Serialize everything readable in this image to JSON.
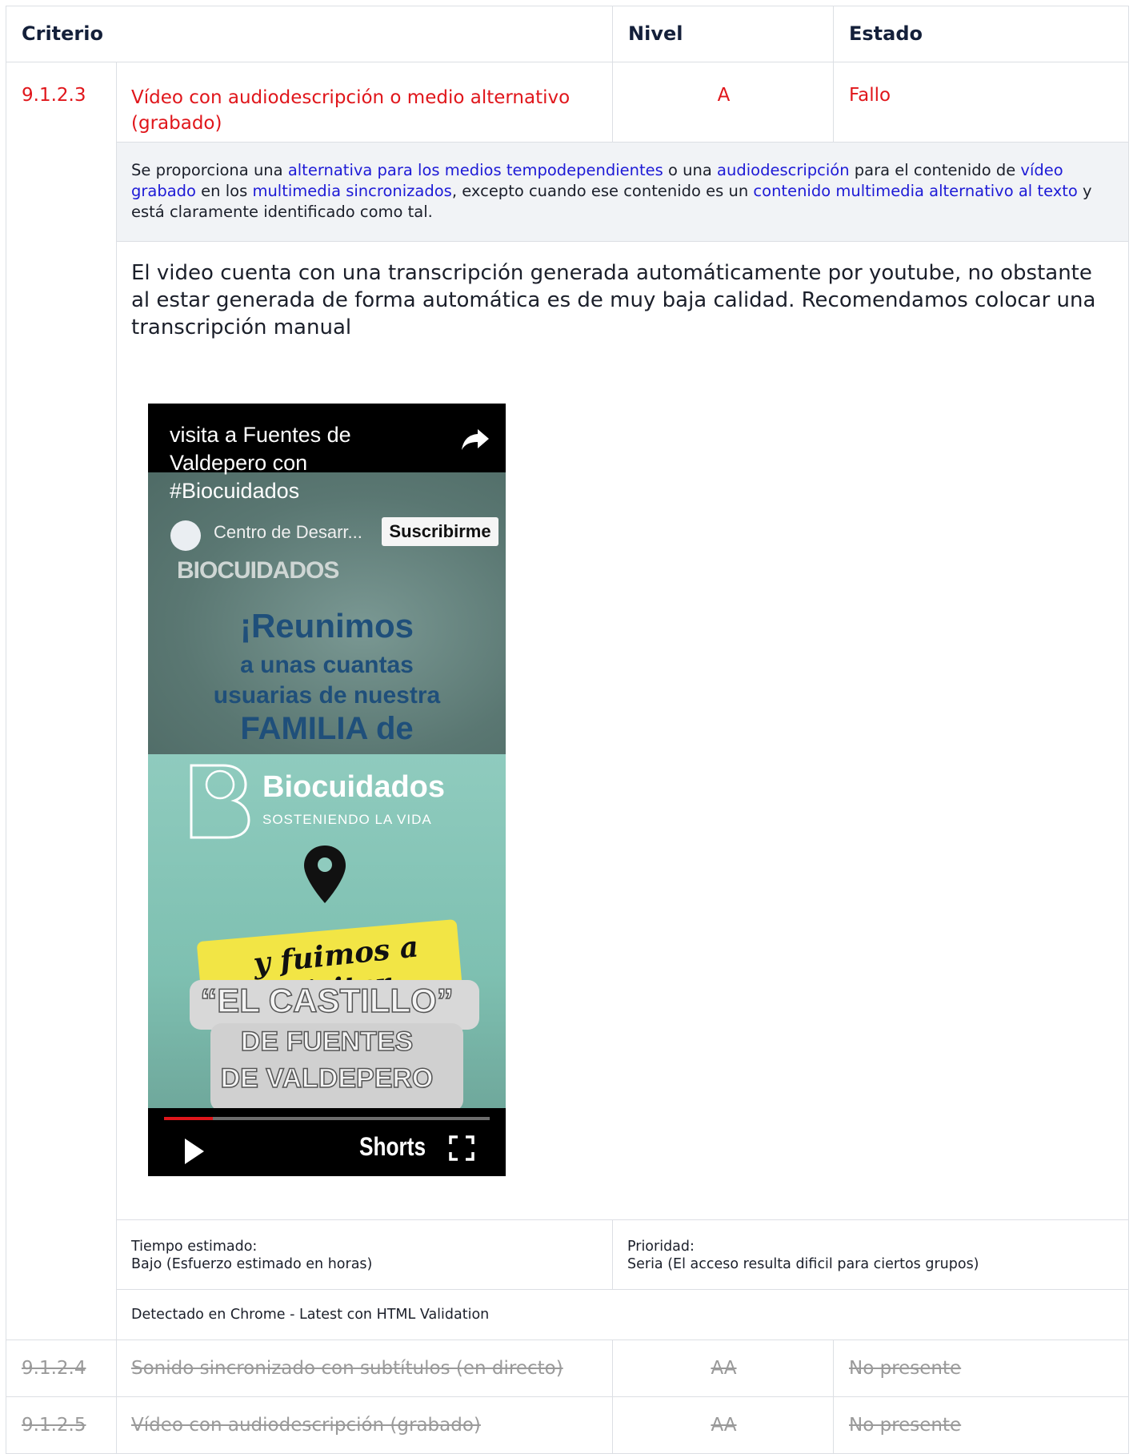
{
  "header": {
    "criterio": "Criterio",
    "nivel": "Nivel",
    "estado": "Estado"
  },
  "main_row": {
    "id": "9.1.2.3",
    "title": "Vídeo con audiodescripción o medio alternativo (grabado)",
    "level": "A",
    "status": "Fallo"
  },
  "description": {
    "p1": "Se proporciona una ",
    "l1": "alternativa para los medios tempodependientes",
    "p2": " o una ",
    "l2": "audiodescripción",
    "p3": " para el contenido de ",
    "l3": "vídeo grabado",
    "p4": " en los ",
    "l4": "multimedia sincronizados",
    "p5": ", excepto cuando ese contenido es un ",
    "l5": "contenido multimedia alternativo al texto",
    "p6": " y está claramente identificado como tal."
  },
  "finding": "El video cuenta con una transcripción generada automáticamente por youtube, no obstante al estar generada de forma automática es de muy baja calidad. Recomendamos colocar una transcripción manual",
  "video": {
    "title": "visita a Fuentes de Valdepero con #Biocuidados",
    "channel": "Centro de Desarr...",
    "subscribe": "Suscribirme",
    "overlay_brand": "BIOCUIDADOS",
    "text1": "¡Reunimos",
    "text2": "a unas cuantas",
    "text3": "usuarias de nuestra",
    "text4": "FAMILIA de",
    "logo_name": "Biocuidados",
    "logo_tag": "SOSTENIENDO LA VIDA",
    "script": "y fuimos a visitar",
    "castle1": "“EL CASTILLO”",
    "castle2": "DE FUENTES",
    "castle3": "DE VALDEPERO",
    "shorts": "Shorts",
    "progress": 0.15,
    "icons": [
      "share-icon",
      "play-icon",
      "fullscreen-icon",
      "location-pin-icon"
    ]
  },
  "meta": {
    "time_label": "Tiempo estimado:",
    "time_value": "Bajo (Esfuerzo estimado en horas)",
    "priority_label": "Prioridad:",
    "priority_value": "Seria (El acceso resulta dificil para ciertos grupos)",
    "detected": "Detectado en Chrome - Latest con HTML Validation"
  },
  "other_rows": [
    {
      "id": "9.1.2.4",
      "title": "Sonido sincronizado con subtítulos (en directo)",
      "level": "AA",
      "status": "No presente"
    },
    {
      "id": "9.1.2.5",
      "title": "Vídeo con audiodescripción (grabado)",
      "level": "AA",
      "status": "No presente"
    }
  ],
  "colors": {
    "fail": "#e0161b",
    "link": "#1d1ad6",
    "muted": "#9a9a9a",
    "desc_bg": "#f1f3f6",
    "border": "#dcdfe4"
  }
}
